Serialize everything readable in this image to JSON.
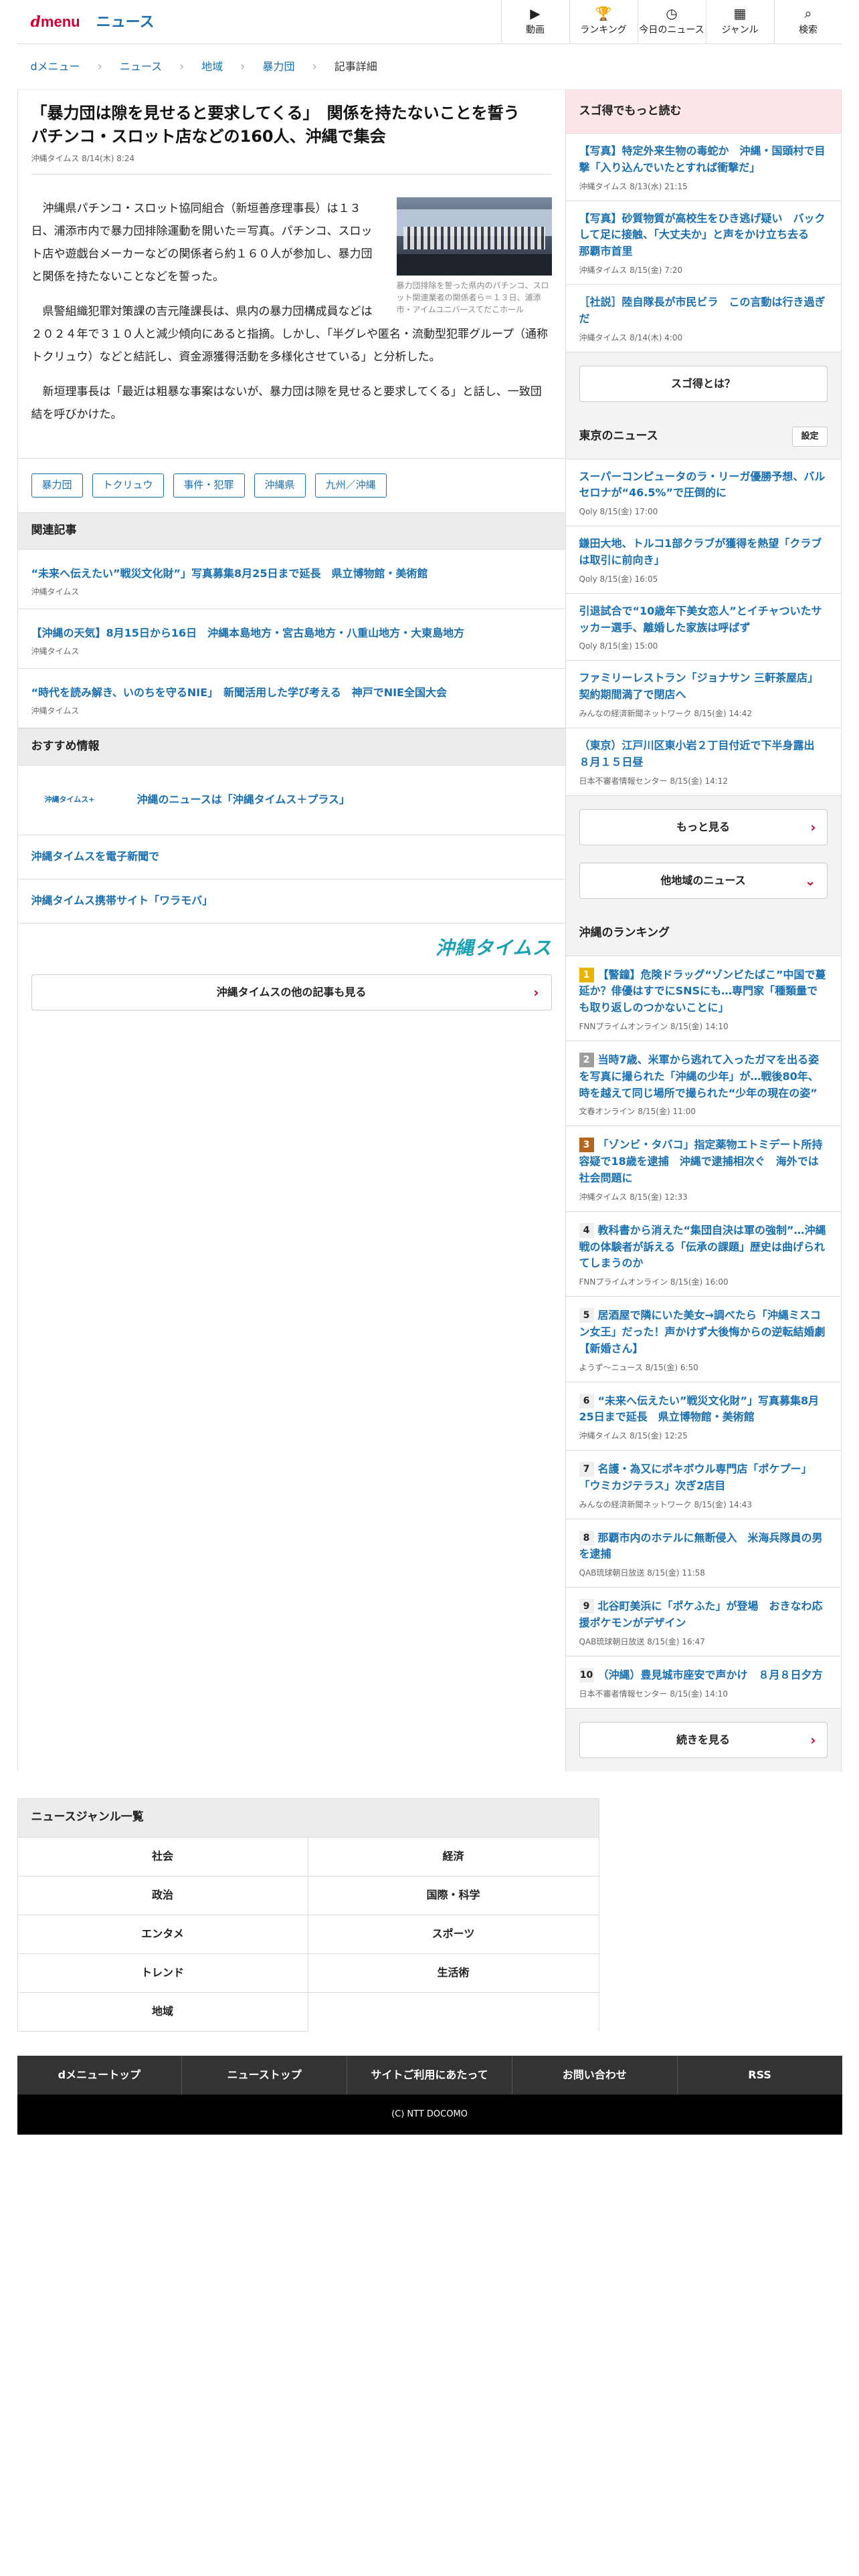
{
  "header": {
    "logo_d": "d",
    "logo_menu": "menu",
    "logo_news": "ニュース",
    "nav": [
      {
        "icon": "▶",
        "label": "動画"
      },
      {
        "icon": "🏆",
        "label": "ランキング"
      },
      {
        "icon": "◷",
        "label": "今日のニュース"
      },
      {
        "icon": "▦",
        "label": "ジャンル"
      },
      {
        "icon": "⌕",
        "label": "検索"
      }
    ]
  },
  "breadcrumb": [
    "dメニュー",
    "ニュース",
    "地域",
    "暴力団",
    "記事詳細"
  ],
  "article": {
    "title": "「暴力団は隙を見せると要求してくる」　関係を持たないことを誓う　パチンコ・スロット店などの160人、沖縄で集会",
    "meta": "沖縄タイムス 8/14(木) 8:24",
    "caption": "暴力団排除を誓った県内のパチンコ、スロット関連業者の関係者ら＝１３日、浦添市・アイムユニバースてだこホール",
    "paragraphs": [
      "沖縄県パチンコ・スロット協同組合（新垣善彦理事長）は１３日、浦添市内で暴力団排除運動を開いた＝写真。パチンコ、スロット店や遊戯台メーカーなどの関係者ら約１６０人が参加し、暴力団と関係を持たないことなどを誓った。",
      "県警組織犯罪対策課の吉元隆課長は、県内の暴力団構成員などは２０２４年で３１０人と減少傾向にあると指摘。しかし、「半グレや匿名・流動型犯罪グループ（通称トクリュウ）などと結託し、資金源獲得活動を多様化させている」と分析した。",
      "新垣理事長は「最近は粗暴な事案はないが、暴力団は隙を見せると要求してくる」と話し、一致団結を呼びかけた。"
    ],
    "tags": [
      "暴力団",
      "トクリュウ",
      "事件・犯罪",
      "沖縄県",
      "九州／沖縄"
    ]
  },
  "related": {
    "heading": "関連記事",
    "items": [
      {
        "title": "“未来へ伝えたい”戦災文化財”」写真募集8月25日まで延長　県立博物館・美術館",
        "src": "沖縄タイムス"
      },
      {
        "title": "【沖縄の天気】8月15日から16日　沖縄本島地方・宮古島地方・八重山地方・大東島地方",
        "src": "沖縄タイムス"
      },
      {
        "title": "“時代を読み解き、いのちを守るNIE」　新聞活用した学び考える　神戸でNIE全国大会",
        "src": "沖縄タイムス"
      }
    ]
  },
  "recommend": {
    "heading": "おすすめ情報",
    "banner_logo": "沖縄タイムス+",
    "banner_title": "沖縄のニュースは「沖縄タイムス＋プラス」",
    "links": [
      "沖縄タイムスを電子新聞で",
      "沖縄タイムス携帯サイト「ワラモバ」"
    ],
    "brand": "沖縄タイムス",
    "more": "沖縄タイムスの他の記事も見る"
  },
  "side_sugotoku": {
    "heading": "スゴ得でもっと読む",
    "items": [
      {
        "title": "【写真】特定外来生物の毒蛇か　沖縄・国頭村で目撃「入り込んでいたとすれば衝撃だ」",
        "src": "沖縄タイムス 8/13(水) 21:15"
      },
      {
        "title": "【写真】砂質物質が高校生をひき逃げ疑い　バックして足に接触、「大丈夫か」と声をかけ立ち去る　那覇市首里",
        "src": "沖縄タイムス 8/15(金) 7:20"
      },
      {
        "title": "［社説］陸自隊長が市民ビラ　この言動は行き過ぎだ",
        "src": "沖縄タイムス 8/14(木) 4:00"
      }
    ],
    "button": "スゴ得とは？"
  },
  "side_tokyo": {
    "heading": "東京のニュース",
    "setting": "設定",
    "items": [
      {
        "title": "スーパーコンピュータのラ・リーガ優勝予想、バルセロナが“46.5%”で圧倒的に",
        "src": "Qoly 8/15(金) 17:00"
      },
      {
        "title": "鎌田大地、トルコ1部クラブが獲得を熱望「クラブは取引に前向き」",
        "src": "Qoly 8/15(金) 16:05"
      },
      {
        "title": "引退試合で“10歳年下美女恋人”とイチャついたサッカー選手、離婚した家族は呼ばず",
        "src": "Qoly 8/15(金) 15:00"
      },
      {
        "title": "ファミリーレストラン「ジョナサン 三軒茶屋店」契約期間満了で閉店へ",
        "src": "みんなの経済新聞ネットワーク 8/15(金) 14:42"
      },
      {
        "title": "（東京）江戸川区東小岩２丁目付近で下半身露出 ８月１５日昼",
        "src": "日本不審者情報センター 8/15(金) 14:12"
      }
    ],
    "more": "もっと見る",
    "other": "他地域のニュース"
  },
  "side_ranking": {
    "heading": "沖縄のランキング",
    "items": [
      {
        "num": "1",
        "title": "【警鐘】危険ドラッグ“ゾンビたばこ”中国で蔓延か？俳優はすでにSNSにも…専門家「種類量でも取り返しのつかないことに」",
        "src": "FNNプライムオンライン 8/15(金) 14:10"
      },
      {
        "num": "2",
        "title": "当時7歳、米軍から逃れて入ったガマを出る姿を写真に撮られた「沖縄の少年」が…戦後80年、時を越えて同じ場所で撮られた“少年の現在の姿”",
        "src": "文春オンライン 8/15(金) 11:00"
      },
      {
        "num": "3",
        "title": "「ゾンビ・タバコ」指定薬物エトミデート所持容疑で18歳を逮捕　沖縄で逮捕相次ぐ　海外では社会問題に",
        "src": "沖縄タイムス 8/15(金) 12:33"
      },
      {
        "num": "4",
        "title": "教科書から消えた“集団自決は軍の強制”…沖縄戦の体験者が訴える「伝承の課題」歴史は曲げられてしまうのか",
        "src": "FNNプライムオンライン 8/15(金) 16:00"
      },
      {
        "num": "5",
        "title": "居酒屋で隣にいた美女→調べたら「沖縄ミスコン女王」だった！声かけず大後悔からの逆転結婚劇【新婚さん】",
        "src": "ようず〜ニュース 8/15(金) 6:50"
      },
      {
        "num": "6",
        "title": "“未来へ伝えたい”戦災文化財”」写真募集8月25日まで延長　県立博物館・美術館",
        "src": "沖縄タイムス 8/15(金) 12:25"
      },
      {
        "num": "7",
        "title": "名護・為又にポキボウル専門店「ポケプー」「ウミカジテラス」次ぎ2店目",
        "src": "みんなの経済新聞ネットワーク 8/15(金) 14:43"
      },
      {
        "num": "8",
        "title": "那覇市内のホテルに無断侵入　米海兵隊員の男を逮捕",
        "src": "QAB琉球朝日放送 8/15(金) 11:58"
      },
      {
        "num": "9",
        "title": "北谷町美浜に「ポケふた」が登場　おきなわ応援ポケモンがデザイン",
        "src": "QAB琉球朝日放送 8/15(金) 16:47"
      },
      {
        "num": "10",
        "title": "（沖縄）豊見城市座安で声かけ　８月８日夕方",
        "src": "日本不審者情報センター 8/15(金) 14:10"
      }
    ],
    "more": "続きを見る"
  },
  "genres": {
    "heading": "ニュースジャンル一覧",
    "items": [
      "社会",
      "経済",
      "政治",
      "国際・科学",
      "エンタメ",
      "スポーツ",
      "トレンド",
      "生活術",
      "地域"
    ]
  },
  "footer": {
    "nav": [
      "dメニュートップ",
      "ニューストップ",
      "サイトご利用にあたって",
      "お問い合わせ",
      "RSS"
    ],
    "copyright": "(C) NTT DOCOMO"
  },
  "colors": {
    "accent": "#cc0033",
    "link": "#1a6fb0",
    "brand": "#1aa0b4"
  }
}
